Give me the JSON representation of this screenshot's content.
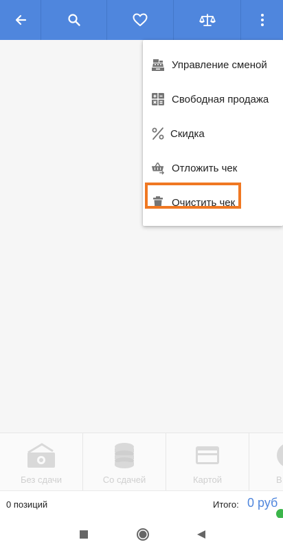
{
  "toolbar": {
    "icons": [
      "back-arrow-icon",
      "search-icon",
      "heart-icon",
      "scales-icon",
      "more-vertical-icon"
    ],
    "color": "#4f86dd"
  },
  "menu": {
    "items": [
      {
        "icon": "cash-register-icon",
        "label": "Управление сменой"
      },
      {
        "icon": "calculator-icon",
        "label": "Свободная продажа"
      },
      {
        "icon": "percent-icon",
        "label": "Скидка"
      },
      {
        "icon": "basket-icon",
        "label": "Отложить чек"
      },
      {
        "icon": "trash-icon",
        "label": "Очистить чек"
      }
    ],
    "highlight_color": "#f07822"
  },
  "payment": {
    "buttons": [
      {
        "icon": "banknote-icon",
        "label": "Без сдачи"
      },
      {
        "icon": "coins-icon",
        "label": "Со сдачей"
      },
      {
        "icon": "card-icon",
        "label": "Картой"
      },
      {
        "icon": "other-payment-icon",
        "label": "В"
      }
    ]
  },
  "footer": {
    "count_text": "0 позиций",
    "total_label": "Итого:",
    "total_value": "0 руб",
    "accent": "#4f86dd"
  },
  "navbar": {
    "icons": [
      "recents-icon",
      "home-icon",
      "back-triangle-icon"
    ]
  }
}
